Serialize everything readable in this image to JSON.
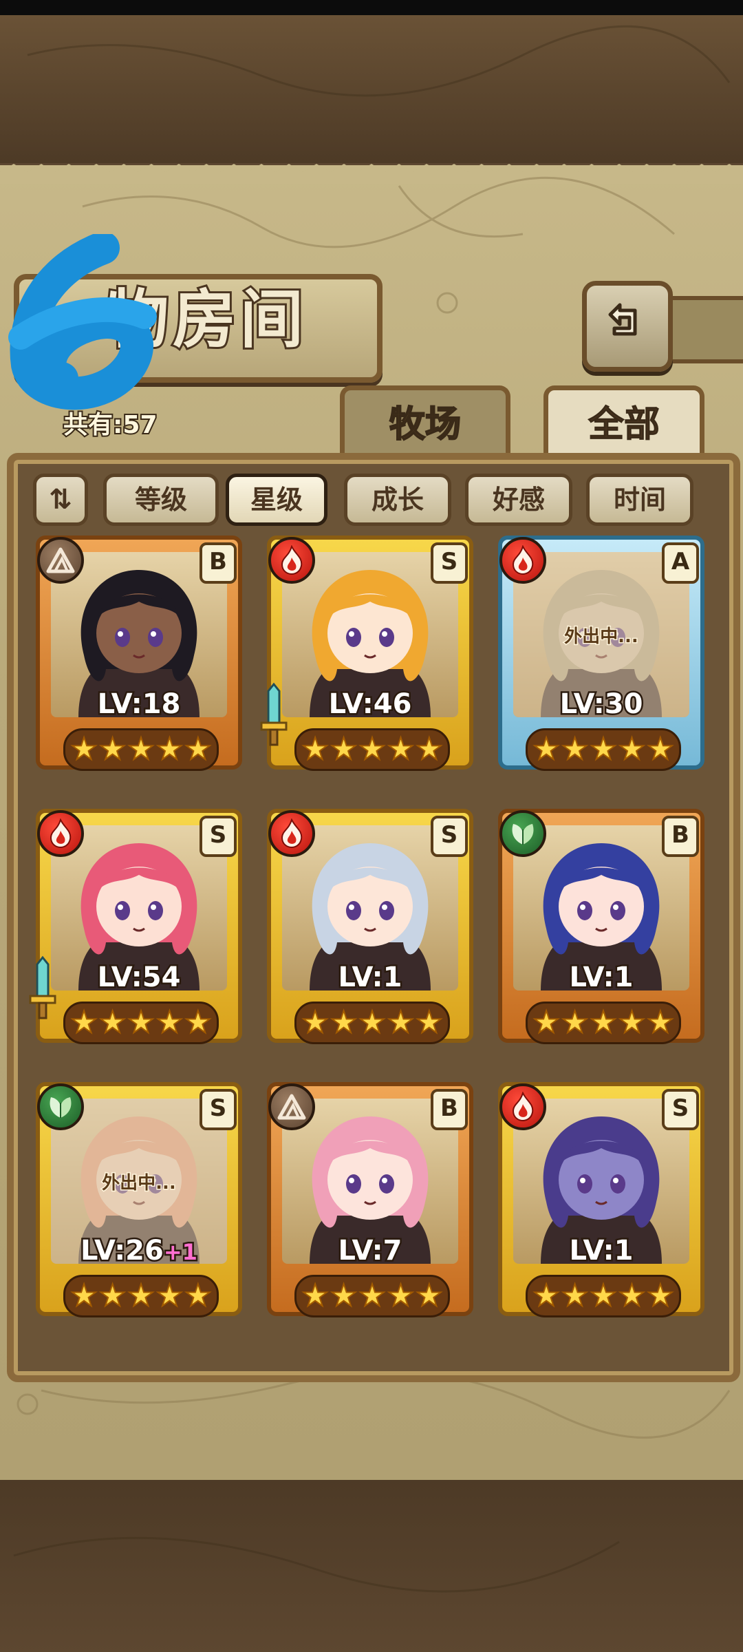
{
  "header": {
    "title": "物房间",
    "total_label": "共有:57",
    "back_icon": "return-arrow-icon"
  },
  "tabs": [
    {
      "label": "牧场",
      "active": false
    },
    {
      "label": "全部",
      "active": true
    }
  ],
  "sort": {
    "toggle_icon": "sort-order-icon",
    "buttons": [
      {
        "label": "等级",
        "active": false
      },
      {
        "label": "星级",
        "active": true
      },
      {
        "label": "成长",
        "active": false
      },
      {
        "label": "好感",
        "active": false
      },
      {
        "label": "时间",
        "active": false
      }
    ]
  },
  "cards": [
    {
      "element": "earth",
      "rank": "B",
      "level": "LV:18",
      "bonus": "",
      "stars": 5,
      "frame": "bronze",
      "away": "",
      "weapon": false,
      "hair": "#1e1a22",
      "skin": "#8a5f48"
    },
    {
      "element": "fire",
      "rank": "S",
      "level": "LV:46",
      "bonus": "",
      "stars": 5,
      "frame": "gold",
      "away": "",
      "weapon": true,
      "hair": "#f0a830",
      "skin": "#fde6d2"
    },
    {
      "element": "fire",
      "rank": "A",
      "level": "LV:30",
      "bonus": "",
      "stars": 5,
      "frame": "blue",
      "away": "外出中...",
      "weapon": false,
      "hair": "#b4a888",
      "skin": "#d8c8b0"
    },
    {
      "element": "fire",
      "rank": "S",
      "level": "LV:54",
      "bonus": "",
      "stars": 5,
      "frame": "gold",
      "away": "",
      "weapon": true,
      "hair": "#e85a78",
      "skin": "#fde0d4"
    },
    {
      "element": "fire",
      "rank": "S",
      "level": "LV:1",
      "bonus": "",
      "stars": 5,
      "frame": "gold",
      "away": "",
      "weapon": false,
      "hair": "#c8d4e4",
      "skin": "#fde6d8"
    },
    {
      "element": "leaf",
      "rank": "B",
      "level": "LV:1",
      "bonus": "",
      "stars": 5,
      "frame": "bronze",
      "away": "",
      "weapon": false,
      "hair": "#3440a0",
      "skin": "#fde2da"
    },
    {
      "element": "leaf",
      "rank": "S",
      "level": "LV:26",
      "bonus": "+1",
      "stars": 5,
      "frame": "gold",
      "away": "外出中...",
      "weapon": false,
      "hair": "#e8a080",
      "skin": "#f4d8c4"
    },
    {
      "element": "earth",
      "rank": "B",
      "level": "LV:7",
      "bonus": "",
      "stars": 5,
      "frame": "bronze",
      "away": "",
      "weapon": false,
      "hair": "#f0a0b8",
      "skin": "#fde4dc"
    },
    {
      "element": "fire",
      "rank": "S",
      "level": "LV:1",
      "bonus": "",
      "stars": 5,
      "frame": "gold",
      "away": "",
      "weapon": false,
      "hair": "#4a3c8c",
      "skin": "#8e86c8"
    }
  ]
}
